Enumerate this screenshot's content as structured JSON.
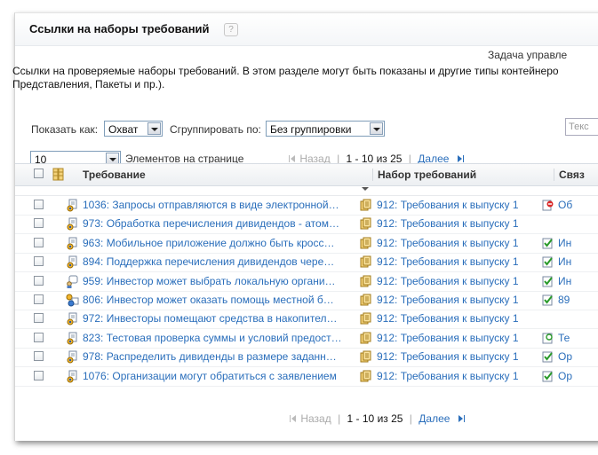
{
  "header": {
    "title": "Ссылки на наборы требований",
    "help_label": "?"
  },
  "task_label": "Задача управле",
  "description": [
    "Ссылки на проверяемые наборы требований. В этом разделе могут быть показаны и другие типы контейнеро",
    "Представления, Пакеты и пр.)."
  ],
  "controls": {
    "show_as_label": "Показать как:",
    "show_as_value": "Охват",
    "group_by_label": "Сгруппировать по:",
    "group_by_value": "Без группировки",
    "filter_placeholder": "Текс"
  },
  "paging": {
    "page_size": "10",
    "page_size_label": "Элементов на странице",
    "back": "Назад",
    "range": "1 - 10 из 25",
    "next": "Далее"
  },
  "table": {
    "headers": {
      "requirement": "Требование",
      "set": "Набор требований",
      "link": "Связ"
    },
    "sort_caret": "chevron-down-icon",
    "rows": [
      {
        "req": "1036: Запросы отправляются в виде электронной…",
        "req_icon": "requirement-icon",
        "set": "912: Требования к выпуску 1",
        "rel_icon": "blocked-icon",
        "rel": "Об"
      },
      {
        "req": "973: Обработка перечисления дивидендов - атом…",
        "req_icon": "requirement-icon",
        "set": "912: Требования к выпуску 1",
        "rel_icon": "",
        "rel": ""
      },
      {
        "req": "963: Мобильное приложение должно быть кросс…",
        "req_icon": "requirement-icon",
        "set": "912: Требования к выпуску 1",
        "rel_icon": "testcase-icon",
        "rel": "Ин"
      },
      {
        "req": "894: Поддержка перечисления дивидендов чере…",
        "req_icon": "requirement-icon",
        "set": "912: Требования к выпуску 1",
        "rel_icon": "testcase-icon",
        "rel": "Ин"
      },
      {
        "req": "959: Инвестор может выбрать локальную органи…",
        "req_icon": "user-requirement-icon",
        "set": "912: Требования к выпуску 1",
        "rel_icon": "testcase-icon",
        "rel": "Ин"
      },
      {
        "req": "806: Инвестор может оказать помощь местной б…",
        "req_icon": "feature-icon",
        "set": "912: Требования к выпуску 1",
        "rel_icon": "testcase-icon",
        "rel": "89"
      },
      {
        "req": "972: Инвесторы помещают средства в накопител…",
        "req_icon": "requirement-icon",
        "set": "912: Требования к выпуску 1",
        "rel_icon": "",
        "rel": ""
      },
      {
        "req": "823: Тестовая проверка суммы и условий предост…",
        "req_icon": "requirement-icon",
        "set": "912: Требования к выпуску 1",
        "rel_icon": "test-icon",
        "rel": "Те"
      },
      {
        "req": "978: Распределить дивиденды в размере заданн…",
        "req_icon": "requirement-icon",
        "set": "912: Требования к выпуску 1",
        "rel_icon": "testcase-icon",
        "rel": "Ор"
      },
      {
        "req": "1076: Организации могут обратиться с заявлением",
        "req_icon": "requirement-icon",
        "set": "912: Требования к выпуску 1",
        "rel_icon": "testcase-icon",
        "rel": "Ор"
      }
    ]
  }
}
